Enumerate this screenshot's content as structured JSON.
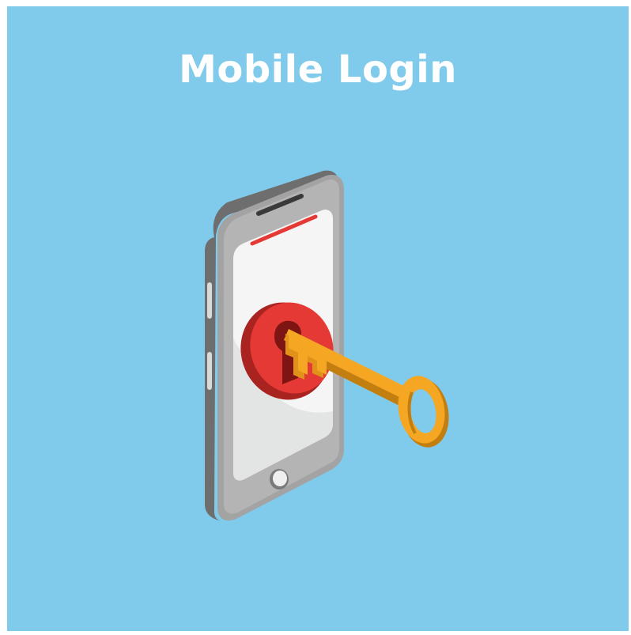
{
  "title": "Mobile Login",
  "colors": {
    "background": "#80CBEC",
    "title_text": "#FFFFFF",
    "phone_body": "#9A9A9A",
    "phone_screen": "#F4F4F4",
    "lock": "#E53935",
    "key": "#F5A623"
  },
  "illustration": {
    "icons": [
      "smartphone-icon",
      "keyhole-lock-icon",
      "key-icon"
    ]
  }
}
